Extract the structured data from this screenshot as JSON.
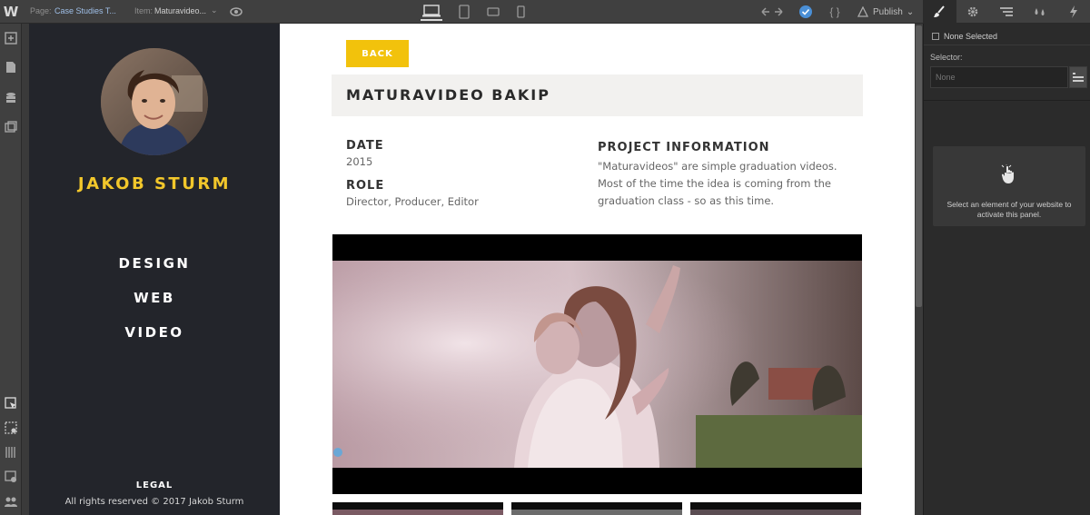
{
  "toolbar": {
    "logo": "W",
    "page_label": "Page:",
    "page_value": "Case Studies T...",
    "item_label": "Item:",
    "item_value": "Maturavideo...",
    "chevron": "⌄",
    "publish_label": "Publish",
    "code_glyph": "{ }"
  },
  "site": {
    "name": "JAKOB STURM",
    "nav": [
      "DESIGN",
      "WEB",
      "VIDEO"
    ],
    "legal_title": "LEGAL",
    "legal_text": "All rights reserved © 2017 Jakob Sturm"
  },
  "content": {
    "back_label": "BACK",
    "title": "MATURAVIDEO BAKIP",
    "date_label": "DATE",
    "date_value": "2015",
    "role_label": "ROLE",
    "role_value": "Director, Producer, Editor",
    "project_label": "PROJECT INFORMATION",
    "project_text": "\"Maturavideos\" are simple graduation videos. Most of the time the idea is coming from the graduation class - so as this time."
  },
  "panel": {
    "none_selected": "None Selected",
    "selector_label": "Selector:",
    "selector_placeholder": "None",
    "empty_text": "Select an element of your website to activate this panel."
  },
  "colors": {
    "accent_yellow": "#f2c20c",
    "sidebar_dark": "#23252b",
    "toolbar": "#404040"
  }
}
